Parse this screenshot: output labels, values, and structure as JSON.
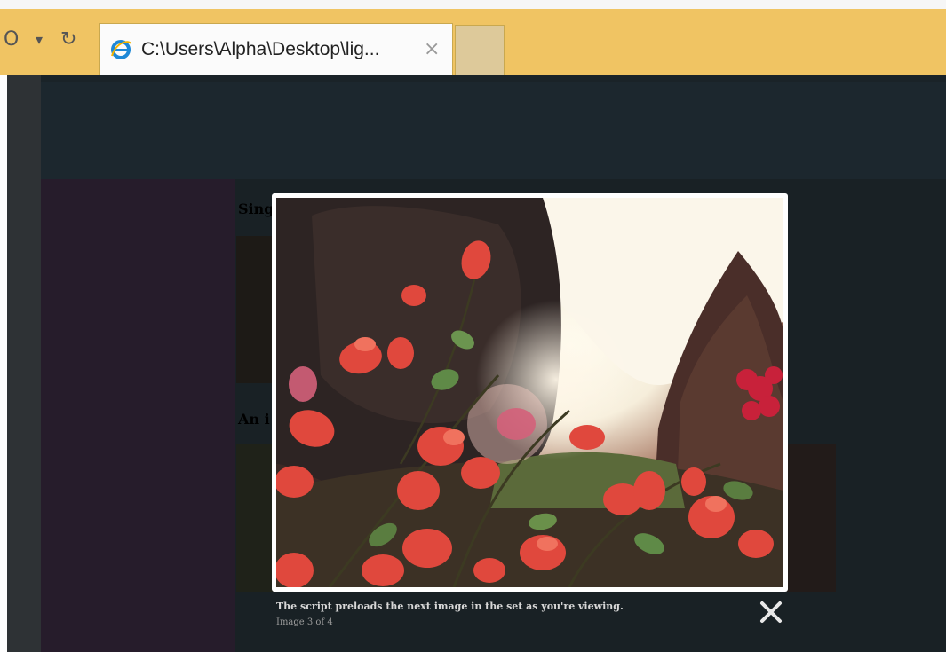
{
  "browser": {
    "tab": {
      "title": "C:\\Users\\Alpha\\Desktop\\lig...",
      "close_glyph": "×",
      "icon": "ie-icon"
    },
    "controls": {
      "search_glyph": "O",
      "dropdown_glyph": "▾",
      "refresh_glyph": "↻"
    }
  },
  "page": {
    "behind_heading_1": "Sing",
    "behind_heading_2": "An i"
  },
  "lightbox": {
    "caption": "The script preloads the next image in the set as you're viewing.",
    "counter": "Image 3 of 4",
    "close_icon": "close-icon"
  },
  "colors": {
    "tabbar": "#f0c463",
    "overlay": "#1a2328",
    "frame": "#ffffff"
  }
}
